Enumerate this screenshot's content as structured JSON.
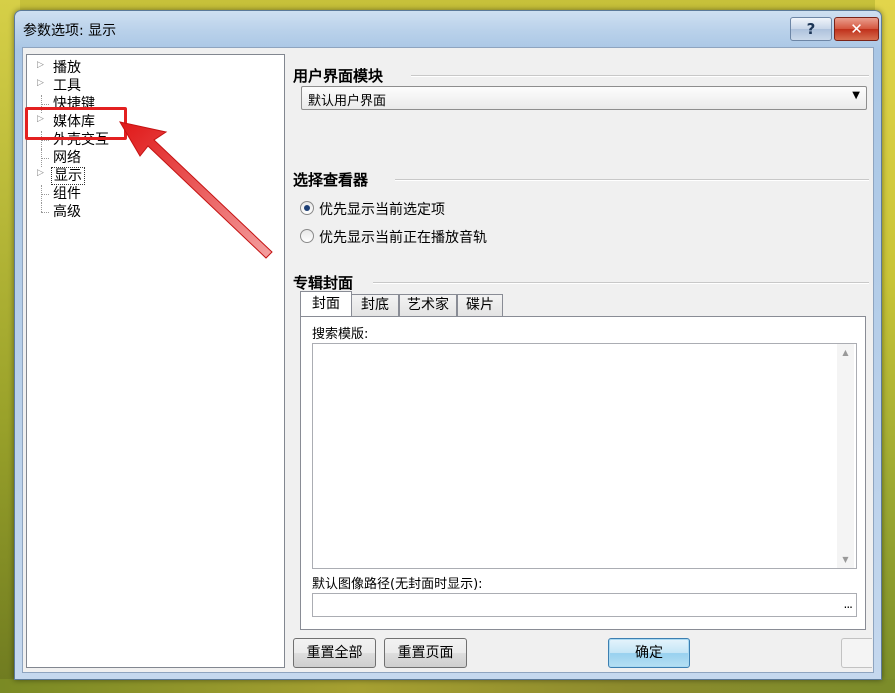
{
  "window": {
    "title": "参数选项: 显示",
    "help_label": "?",
    "close_label": "✕"
  },
  "tree": {
    "items": [
      {
        "label": "播放",
        "expandable": true
      },
      {
        "label": "工具",
        "expandable": true
      },
      {
        "label": "快捷键",
        "expandable": false
      },
      {
        "label": "媒体库",
        "expandable": true
      },
      {
        "label": "外壳交互",
        "expandable": false
      },
      {
        "label": "网络",
        "expandable": false
      },
      {
        "label": "显示",
        "expandable": true,
        "selected": true
      },
      {
        "label": "组件",
        "expandable": false
      },
      {
        "label": "高级",
        "expandable": false
      }
    ]
  },
  "ui_module": {
    "title": "用户界面模块",
    "selected": "默认用户界面"
  },
  "viewer": {
    "title": "选择查看器",
    "options": [
      {
        "label": "优先显示当前选定项",
        "checked": true
      },
      {
        "label": "优先显示当前正在播放音轨",
        "checked": false
      }
    ]
  },
  "album_art": {
    "title": "专辑封面",
    "tabs": [
      "封面",
      "封底",
      "艺术家",
      "碟片"
    ],
    "active_tab": 0,
    "search_template_label": "搜索模版:",
    "search_template_value": "",
    "default_path_label": "默认图像路径(无封面时显示):",
    "default_path_value": "",
    "browse_label": "..."
  },
  "buttons": {
    "reset_all": "重置全部",
    "reset_page": "重置页面",
    "ok": "确定"
  },
  "colors": {
    "annotation_red": "#e32020",
    "accent_blue": "#3c7fb1"
  }
}
